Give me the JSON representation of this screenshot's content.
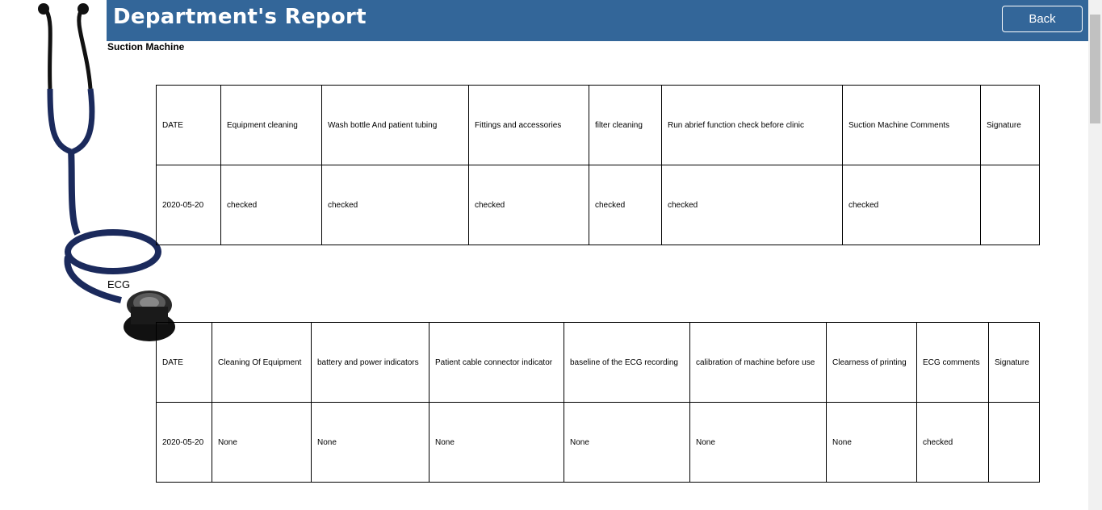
{
  "header": {
    "title": "Department's Report",
    "back_label": "Back",
    "background_color": "#336699"
  },
  "sections": [
    {
      "title": "Suction Machine",
      "columns": [
        "DATE",
        "Equipment cleaning",
        "Wash bottle And patient tubing",
        "Fittings and accessories",
        "filter cleaning",
        "Run abrief function check before clinic",
        "Suction Machine Comments",
        "Signature"
      ],
      "rows": [
        [
          "2020-05-20",
          "checked",
          "checked",
          "checked",
          "checked",
          "checked",
          "checked",
          ""
        ]
      ]
    },
    {
      "title": "ECG",
      "columns": [
        "DATE",
        "Cleaning Of Equipment",
        "battery and power indicators",
        "Patient cable connector indicator",
        "baseline of the ECG recording",
        "calibration of machine before use",
        "Clearness of printing",
        "ECG comments",
        "Signature"
      ],
      "rows": [
        [
          "2020-05-20",
          "None",
          "None",
          "None",
          "None",
          "None",
          "None",
          "checked",
          ""
        ]
      ]
    }
  ],
  "decor": {
    "image": "stethoscope-image",
    "tube_color": "#1b2a5c"
  }
}
